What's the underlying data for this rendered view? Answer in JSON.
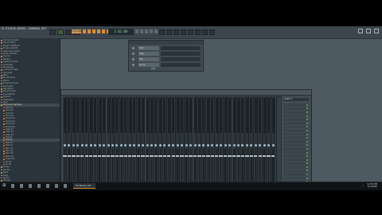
{
  "window": {
    "title": "FL STUDIO   DEMO - MINIMAL SET",
    "lcd": "1:01:00"
  },
  "transport": {
    "tempo": "130.000"
  },
  "browser": {
    "rows": [
      {
        "label": "Current project",
        "kind": "folder"
      },
      {
        "label": "Recent files",
        "kind": "folder"
      },
      {
        "label": "Plugin database",
        "kind": "folder"
      },
      {
        "label": "Plugin presets",
        "kind": "folder"
      },
      {
        "label": "Channel presets",
        "kind": "folder"
      },
      {
        "label": "Mixer presets",
        "kind": "folder"
      },
      {
        "label": "Scores",
        "kind": "folder"
      },
      {
        "label": "Backup",
        "kind": "folder"
      },
      {
        "label": "Clipboard files",
        "kind": "folder"
      },
      {
        "label": "Collected",
        "kind": "folder"
      },
      {
        "label": "Envelopes",
        "kind": "folder"
      },
      {
        "label": "IL shared data",
        "kind": "folder"
      },
      {
        "label": "Impulses",
        "kind": "folder"
      },
      {
        "label": "Misc",
        "kind": "folder"
      },
      {
        "label": "My projects",
        "kind": "folder"
      },
      {
        "label": "Packs",
        "kind": "folder"
      },
      {
        "label": "Projects bones",
        "kind": "folder"
      },
      {
        "label": "Recorded",
        "kind": "folder"
      },
      {
        "label": "Rendered",
        "kind": "folder"
      },
      {
        "label": "Sliced audio",
        "kind": "folder"
      },
      {
        "label": "Soundfonts",
        "kind": "folder"
      },
      {
        "label": "Speech",
        "kind": "folder"
      },
      {
        "label": "Templates",
        "kind": "folder"
      },
      {
        "label": "User",
        "kind": "folder"
      },
      {
        "label": "Producer Samples",
        "kind": "folder",
        "selected": true
      },
      {
        "label": "Kick 01",
        "kind": "item"
      },
      {
        "label": "Kick 02",
        "kind": "item"
      },
      {
        "label": "Kick 03",
        "kind": "item"
      },
      {
        "label": "Kick 04",
        "kind": "item"
      },
      {
        "label": "Snare 01",
        "kind": "item"
      },
      {
        "label": "Snare 02",
        "kind": "item"
      },
      {
        "label": "Snare 03",
        "kind": "item"
      },
      {
        "label": "Snare 04",
        "kind": "item"
      },
      {
        "label": "Clap 01",
        "kind": "item"
      },
      {
        "label": "Clap 02",
        "kind": "item"
      },
      {
        "label": "Clap 03",
        "kind": "item"
      },
      {
        "label": "Hat 01",
        "kind": "item"
      },
      {
        "label": "Hat 02",
        "kind": "item",
        "selected": true
      },
      {
        "label": "Hat 03",
        "kind": "item"
      },
      {
        "label": "Hat 04",
        "kind": "item"
      },
      {
        "label": "Perc 01",
        "kind": "item"
      },
      {
        "label": "Perc 02",
        "kind": "item"
      },
      {
        "label": "Perc 03",
        "kind": "item"
      },
      {
        "label": "Ride 01",
        "kind": "item"
      },
      {
        "label": "Crash 01",
        "kind": "item"
      },
      {
        "label": "Fx 01",
        "kind": "item"
      },
      {
        "label": "Fx 02",
        "kind": "item"
      },
      {
        "label": "Loops",
        "kind": "folder"
      },
      {
        "label": "Vocals",
        "kind": "folder"
      },
      {
        "label": "Bass",
        "kind": "folder"
      },
      {
        "label": "Keys",
        "kind": "folder"
      },
      {
        "label": "Synth",
        "kind": "folder"
      },
      {
        "label": "Strings",
        "kind": "folder"
      }
    ]
  },
  "channel_rack": {
    "channels": [
      "Kick",
      "Clap",
      "Hat",
      "Snare"
    ]
  },
  "mixer": {
    "track_count": 49,
    "slots_header": "Insert 1",
    "slots": 24
  },
  "taskbar": {
    "app_label": "FL Studio 20",
    "time": "12:34 PM",
    "date": "1/1/2020"
  }
}
